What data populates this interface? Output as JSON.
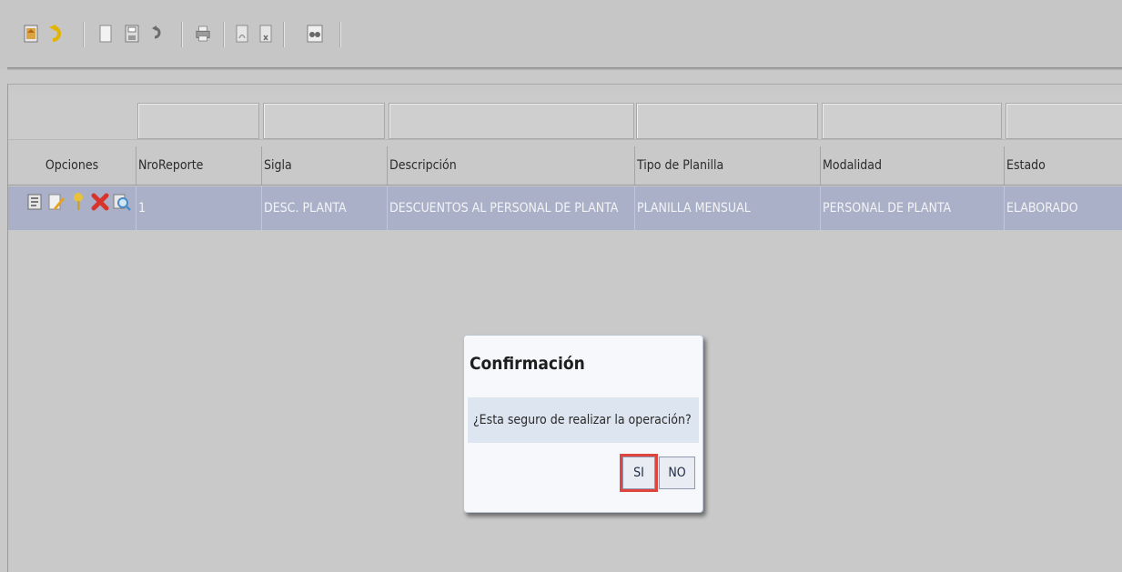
{
  "toolbar": {
    "icons": [
      "home-icon",
      "undo-icon",
      "new-document-icon",
      "save-icon",
      "redo-icon",
      "print-icon",
      "export-pdf-icon",
      "export-excel-icon",
      "search-binoculars-icon"
    ]
  },
  "table": {
    "columns": [
      "Opciones",
      "NroReporte",
      "Sigla",
      "Descripción",
      "Tipo de Planilla",
      "Modalidad",
      "Estado"
    ],
    "rows": [
      {
        "nro": "1",
        "sigla": "DESC. PLANTA",
        "descripcion": "DESCUENTOS AL PERSONAL DE PLANTA",
        "tipo": "PLANILLA MENSUAL",
        "modalidad": "PERSONAL DE PLANTA",
        "estado": "ELABORADO"
      }
    ],
    "row_options_icons": [
      "view-report-icon",
      "edit-icon",
      "key-icon",
      "delete-icon",
      "search-icon"
    ]
  },
  "dialog": {
    "title": "Confirmación",
    "message": "¿Esta seguro de realizar la operación?",
    "yes_label": "SI",
    "no_label": "NO"
  },
  "colors": {
    "selected_row": "#a9b0c7",
    "highlight": "#e0443f"
  }
}
